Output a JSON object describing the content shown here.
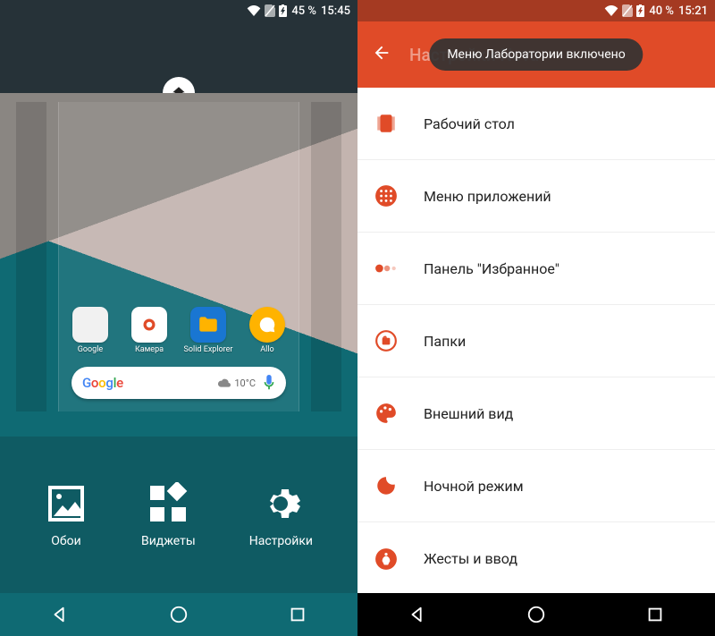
{
  "left": {
    "statusbar": {
      "battery": "45 %",
      "time": "15:45"
    },
    "apps": [
      {
        "label": "Google"
      },
      {
        "label": "Камера"
      },
      {
        "label": "Solid Explorer"
      },
      {
        "label": "Allo"
      }
    ],
    "search": {
      "temp": "10°C"
    },
    "panel": {
      "wallpapers": "Обои",
      "widgets": "Виджеты",
      "settings": "Настройки"
    }
  },
  "right": {
    "statusbar": {
      "battery": "40 %",
      "time": "15:21"
    },
    "appbar_title": "Настройки Nova",
    "toast": "Меню Лаборатории включено",
    "items": [
      {
        "label": "Рабочий стол"
      },
      {
        "label": "Меню приложений"
      },
      {
        "label": "Панель \"Избранное\""
      },
      {
        "label": "Папки"
      },
      {
        "label": "Внешний вид"
      },
      {
        "label": "Ночной режим"
      },
      {
        "label": "Жесты и ввод"
      }
    ]
  }
}
